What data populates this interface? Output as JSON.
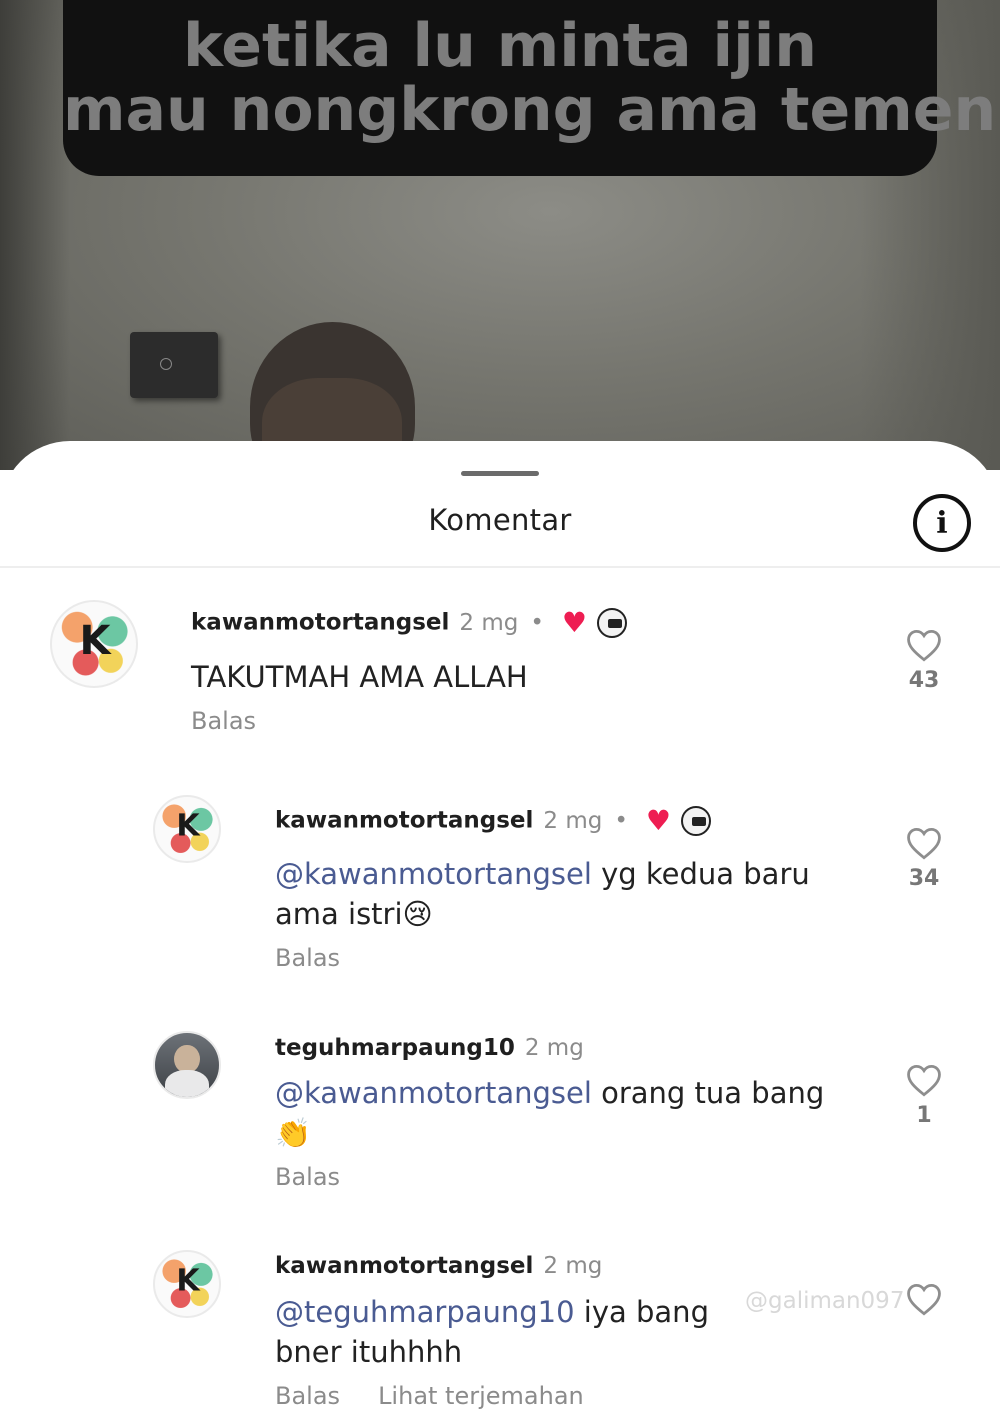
{
  "video": {
    "caption_line1": "ketika lu minta ijin",
    "caption_line2": "mau nongkrong ama temen"
  },
  "sheet": {
    "title": "Komentar",
    "info_icon": "info-icon",
    "info_glyph": "i"
  },
  "comments": [
    {
      "avatar": "kawanmotor-logo",
      "avatar_text": "K",
      "username": "kawanmotortangsel",
      "time": "2 mg",
      "dot": "•",
      "liked_by_creator": true,
      "creator_badge": true,
      "text": "TAKUTMAH AMA ALLAH",
      "reply_label": "Balas",
      "likes": "43"
    },
    {
      "avatar": "kawanmotor-logo",
      "avatar_text": "K",
      "username": "kawanmotortangsel",
      "time": "2 mg",
      "dot": "•",
      "liked_by_creator": true,
      "creator_badge": true,
      "mention": "@kawanmotortangsel",
      "text": " yg kedua baru ama istri😢",
      "reply_label": "Balas",
      "likes": "34"
    },
    {
      "avatar": "teguh-photo",
      "username": "teguhmarpaung10",
      "time": "2 mg",
      "mention": "@kawanmotortangsel",
      "text": " orang tua bang 👏",
      "reply_label": "Balas",
      "likes": "1"
    },
    {
      "avatar": "kawanmotor-logo",
      "avatar_text": "K",
      "username": "kawanmotortangsel",
      "time": "2 mg",
      "mention": "@teguhmarpaung10",
      "text": " iya bang bner ituhhhh",
      "reply_label": "Balas",
      "translate_label": "Lihat terjemahan"
    }
  ],
  "watermark": "@galiman097",
  "colors": {
    "mention": "#4a5b92",
    "heart_badge": "#ee1d52",
    "caption_bg": "#111111",
    "caption_text": "#7d7d7d"
  }
}
